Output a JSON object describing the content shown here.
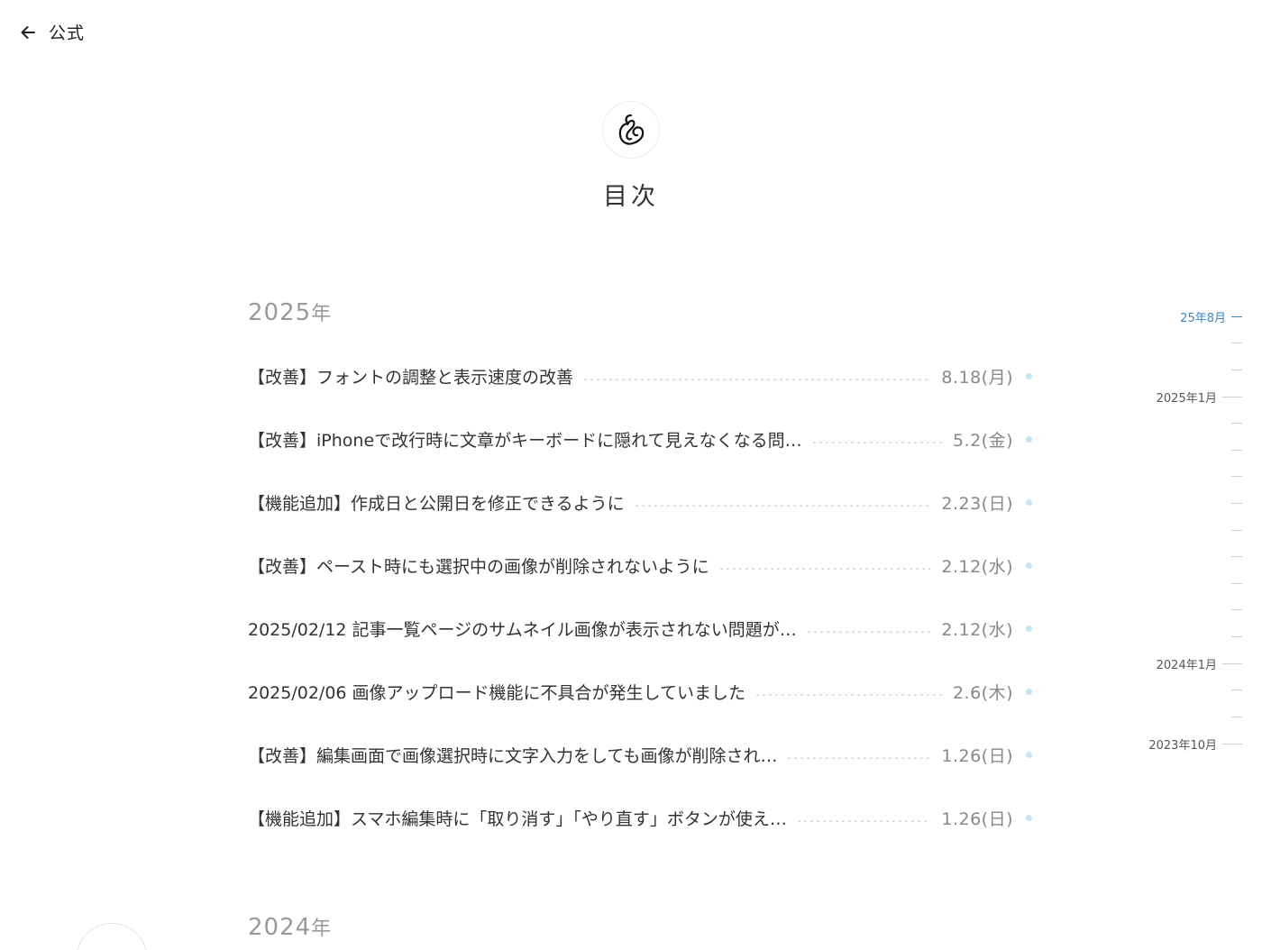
{
  "header": {
    "back_label": "公式",
    "back_icon": "arrow-left-icon"
  },
  "logo": {
    "icon": "note-logo-icon"
  },
  "page_title": "目次",
  "sections": [
    {
      "year": "2025",
      "year_suffix": "年",
      "articles": [
        {
          "title": "【改善】フォントの調整と表示速度の改善",
          "date": "8.18",
          "weekday": "(月)"
        },
        {
          "title": "【改善】iPhoneで改行時に文章がキーボードに隠れて見えなくなる問…",
          "date": "5.2",
          "weekday": "(金)"
        },
        {
          "title": "【機能追加】作成日と公開日を修正できるように",
          "date": "2.23",
          "weekday": "(日)"
        },
        {
          "title": "【改善】ペースト時にも選択中の画像が削除されないように",
          "date": "2.12",
          "weekday": "(水)"
        },
        {
          "title": "2025/02/12 記事一覧ページのサムネイル画像が表示されない問題が…",
          "date": "2.12",
          "weekday": "(水)"
        },
        {
          "title": "2025/02/06 画像アップロード機能に不具合が発生していました",
          "date": "2.6",
          "weekday": "(木)"
        },
        {
          "title": "【改善】編集画面で画像選択時に文字入力をしても画像が削除され…",
          "date": "1.26",
          "weekday": "(日)"
        },
        {
          "title": "【機能追加】スマホ編集時に「取り消す」「やり直す」ボタンが使え…",
          "date": "1.26",
          "weekday": "(日)"
        }
      ]
    },
    {
      "year": "2024",
      "year_suffix": "年",
      "articles": []
    }
  ],
  "timeline": {
    "labels": [
      {
        "text": "25年8月",
        "active": true
      },
      {
        "text": "2025年1月",
        "active": false
      },
      {
        "text": "2024年1月",
        "active": false
      },
      {
        "text": "2023年10月",
        "active": false
      }
    ],
    "colors": {
      "active": "#3b86c6",
      "tick": "#cfcfcf"
    }
  },
  "colors": {
    "status_dot": "#c5e4f7",
    "year_heading": "#9a9a9a"
  }
}
